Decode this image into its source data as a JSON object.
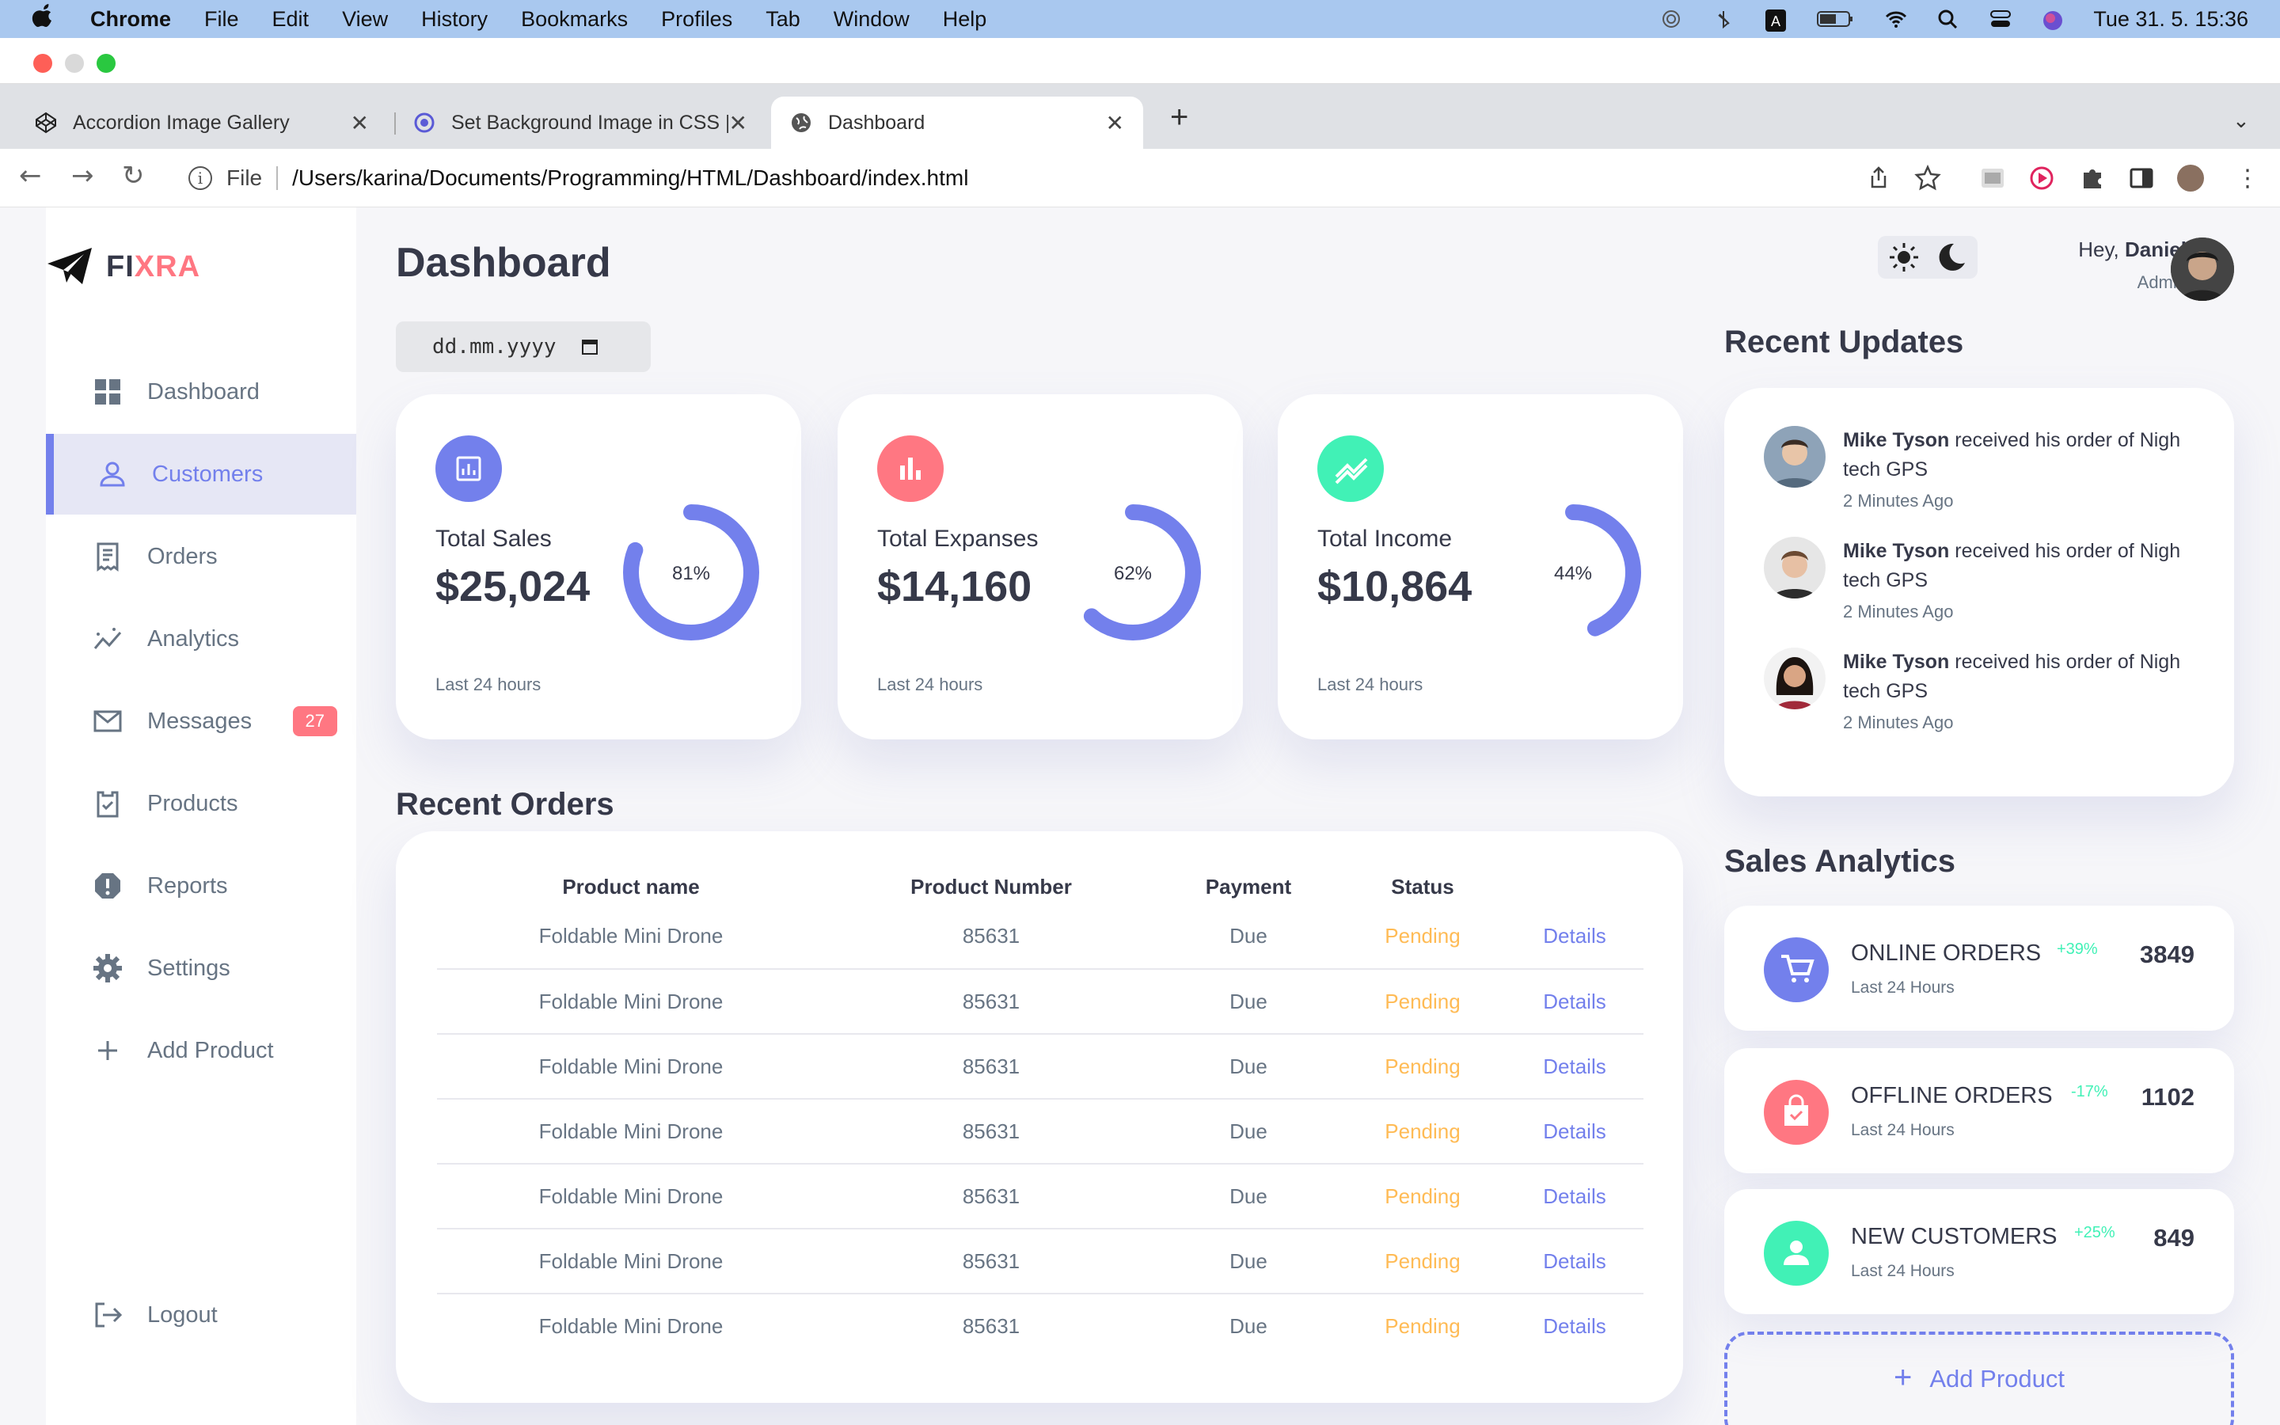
{
  "menubar": {
    "app": "Chrome",
    "items": [
      "File",
      "Edit",
      "View",
      "History",
      "Bookmarks",
      "Profiles",
      "Tab",
      "Window",
      "Help"
    ],
    "clock": "Tue 31. 5.  15:36"
  },
  "browser": {
    "tabs": [
      {
        "title": "Accordion Image Gallery",
        "icon": "codepen-icon"
      },
      {
        "title": "Set Background Image in CSS |",
        "icon": "gear-favicon-icon"
      },
      {
        "title": "Dashboard",
        "icon": "globe-icon"
      }
    ],
    "omnibox": {
      "scheme": "File",
      "url": "/Users/karina/Documents/Programming/HTML/Dashboard/index.html"
    }
  },
  "brand": {
    "part1": "FI",
    "part2": "XRA"
  },
  "sidebar": {
    "items": [
      {
        "label": "Dashboard",
        "icon": "grid-icon"
      },
      {
        "label": "Customers",
        "icon": "person-icon",
        "active": true
      },
      {
        "label": "Orders",
        "icon": "receipt-icon"
      },
      {
        "label": "Analytics",
        "icon": "insights-icon"
      },
      {
        "label": "Messages",
        "icon": "mail-icon",
        "badge": "27"
      },
      {
        "label": "Products",
        "icon": "inventory-icon"
      },
      {
        "label": "Reports",
        "icon": "report-icon"
      },
      {
        "label": "Settings",
        "icon": "gear-icon"
      },
      {
        "label": "Add Product",
        "icon": "plus-icon"
      }
    ],
    "logout": "Logout"
  },
  "main": {
    "title": "Dashboard",
    "date_placeholder": "dd.mm.yyyy",
    "cards": [
      {
        "label": "Total Sales",
        "value": "$25,024",
        "percent": 81,
        "percent_label": "81%",
        "footer": "Last 24 hours",
        "color": "#7380ec"
      },
      {
        "label": "Total Expanses",
        "value": "$14,160",
        "percent": 62,
        "percent_label": "62%",
        "footer": "Last 24 hours",
        "color": "#ff7782"
      },
      {
        "label": "Total Income",
        "value": "$10,864",
        "percent": 44,
        "percent_label": "44%",
        "footer": "Last 24 hours",
        "color": "#41f1b6"
      }
    ],
    "recent_orders": {
      "title": "Recent Orders",
      "headers": [
        "Product name",
        "Product Number",
        "Payment",
        "Status",
        ""
      ],
      "rows": [
        [
          "Foldable Mini Drone",
          "85631",
          "Due",
          "Pending",
          "Details"
        ],
        [
          "Foldable Mini Drone",
          "85631",
          "Due",
          "Pending",
          "Details"
        ],
        [
          "Foldable Mini Drone",
          "85631",
          "Due",
          "Pending",
          "Details"
        ],
        [
          "Foldable Mini Drone",
          "85631",
          "Due",
          "Pending",
          "Details"
        ],
        [
          "Foldable Mini Drone",
          "85631",
          "Due",
          "Pending",
          "Details"
        ],
        [
          "Foldable Mini Drone",
          "85631",
          "Due",
          "Pending",
          "Details"
        ],
        [
          "Foldable Mini Drone",
          "85631",
          "Due",
          "Pending",
          "Details"
        ]
      ]
    }
  },
  "header": {
    "greeting_prefix": "Hey, ",
    "user_name": "Daniel",
    "role": "Admin"
  },
  "recent_updates": {
    "title": "Recent Updates",
    "items": [
      {
        "name": "Mike Tyson",
        "text": " received his order of Nigh tech GPS",
        "time": "2 Minutes Ago"
      },
      {
        "name": "Mike Tyson",
        "text": " received his order of Nigh tech GPS",
        "time": "2 Minutes Ago"
      },
      {
        "name": "Mike Tyson",
        "text": " received his order of Nigh tech GPS",
        "time": "2 Minutes Ago"
      }
    ]
  },
  "sales_analytics": {
    "title": "Sales Analytics",
    "items": [
      {
        "title": "ONLINE ORDERS",
        "footer": "Last 24 Hours",
        "change": "+39%",
        "value": "3849",
        "icon": "cart-icon",
        "color": "#7380ec",
        "change_color": "#41f1b6"
      },
      {
        "title": "OFFLINE ORDERS",
        "footer": "Last 24 Hours",
        "change": "-17%",
        "value": "1102",
        "icon": "bag-icon",
        "color": "#ff7782",
        "change_color": "#41f1b6"
      },
      {
        "title": "NEW CUSTOMERS",
        "footer": "Last 24 Hours",
        "change": "+25%",
        "value": "849",
        "icon": "person-icon",
        "color": "#41f1b6",
        "change_color": "#41f1b6"
      }
    ],
    "add_label": "Add Product"
  }
}
